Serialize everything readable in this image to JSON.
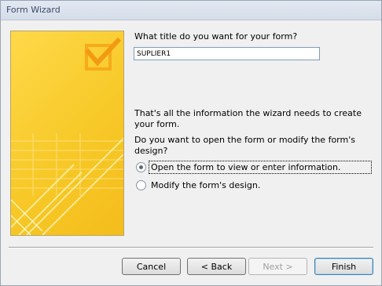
{
  "window": {
    "title": "Form Wizard"
  },
  "form": {
    "title_question": "What title do you want for your form?",
    "title_value": "SUPLIER1",
    "info_text": "That's all the information the wizard needs to create your form.",
    "open_question": "Do you want to open the form or modify the form's design?",
    "options": [
      {
        "label": "Open the form to view or enter information.",
        "selected": true
      },
      {
        "label": "Modify the form's design.",
        "selected": false
      }
    ]
  },
  "buttons": {
    "cancel": "Cancel",
    "back": "< Back",
    "next": "Next >",
    "finish": "Finish"
  },
  "colors": {
    "art_yellow": "#f7c928",
    "accent_blue": "#3c7fb1"
  }
}
